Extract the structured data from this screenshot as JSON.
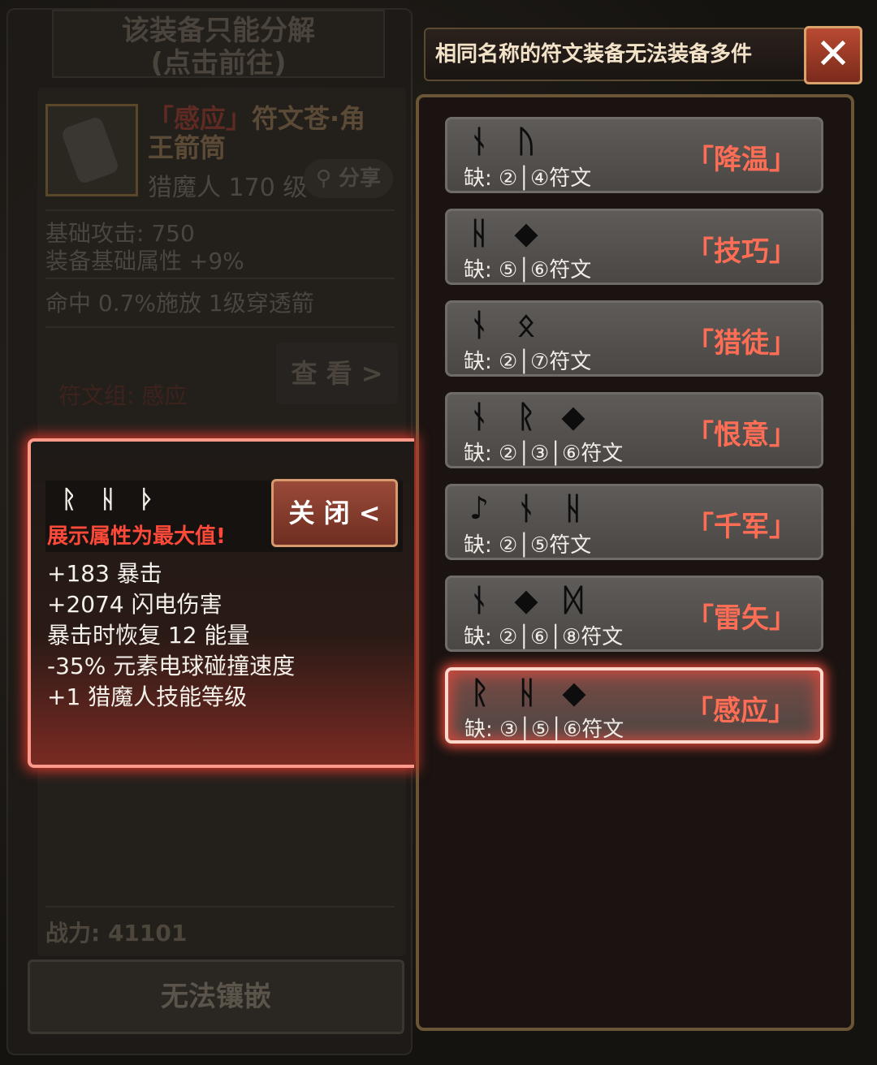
{
  "left_panel": {
    "title_line1": "该装备只能分解",
    "title_line2": "(点击前往)",
    "item_name_prefix": "「感应」",
    "item_name_rest": "符文苍·角王箭筒",
    "item_class": "猎魔人 170 级",
    "share_label": "分享",
    "base_attack": "基础攻击:  750",
    "base_attr": "装备基础属性 +9%",
    "hit_line": "命中 0.7%施放 1级穿透箭",
    "rune_group": "符文组: 感应",
    "view_label": "查 看 >",
    "power_label": "战力: 41101",
    "cant_inlay_label": "无法镶嵌"
  },
  "notice": {
    "text": "相同名称的符文装备无法装备多件",
    "close_label": "✕"
  },
  "rune_sets": [
    {
      "runes": [
        "ᚾ",
        "ᚢ"
      ],
      "missing": "缺:  ②│④符文",
      "name": "「降温」",
      "selected": false
    },
    {
      "runes": [
        "ᚺ",
        "◆"
      ],
      "missing": "缺:  ⑤│⑥符文",
      "name": "「技巧」",
      "selected": false
    },
    {
      "runes": [
        "ᚾ",
        "ᛟ"
      ],
      "missing": "缺:  ②│⑦符文",
      "name": "「猎徒」",
      "selected": false
    },
    {
      "runes": [
        "ᚾ",
        "ᚱ",
        "◆"
      ],
      "missing": "缺:  ②│③│⑥符文",
      "name": "「恨意」",
      "selected": false
    },
    {
      "runes": [
        "♪",
        "ᚾ",
        "ᚺ"
      ],
      "missing": "缺:  ②│⑤符文",
      "name": "「千军」",
      "selected": false
    },
    {
      "runes": [
        "ᚾ",
        "◆",
        "ᛞ"
      ],
      "missing": "缺:  ②│⑥│⑧符文",
      "name": "「雷矢」",
      "selected": false
    },
    {
      "runes": [
        "ᚱ",
        "ᚺ",
        "◆"
      ],
      "missing": "缺:  ③│⑤│⑥符文",
      "name": "「感应」",
      "selected": true
    }
  ],
  "popup": {
    "runes": [
      "ᚱ",
      "ᚺ",
      "ᚦ"
    ],
    "note": "展示属性为最大值!",
    "close_label": "关 闭 <",
    "stats": [
      "+183 暴击",
      "+2074 闪电伤害",
      "暴击时恢复 12 能量",
      "-35% 元素电球碰撞速度",
      "+1 猎魔人技能等级"
    ]
  }
}
